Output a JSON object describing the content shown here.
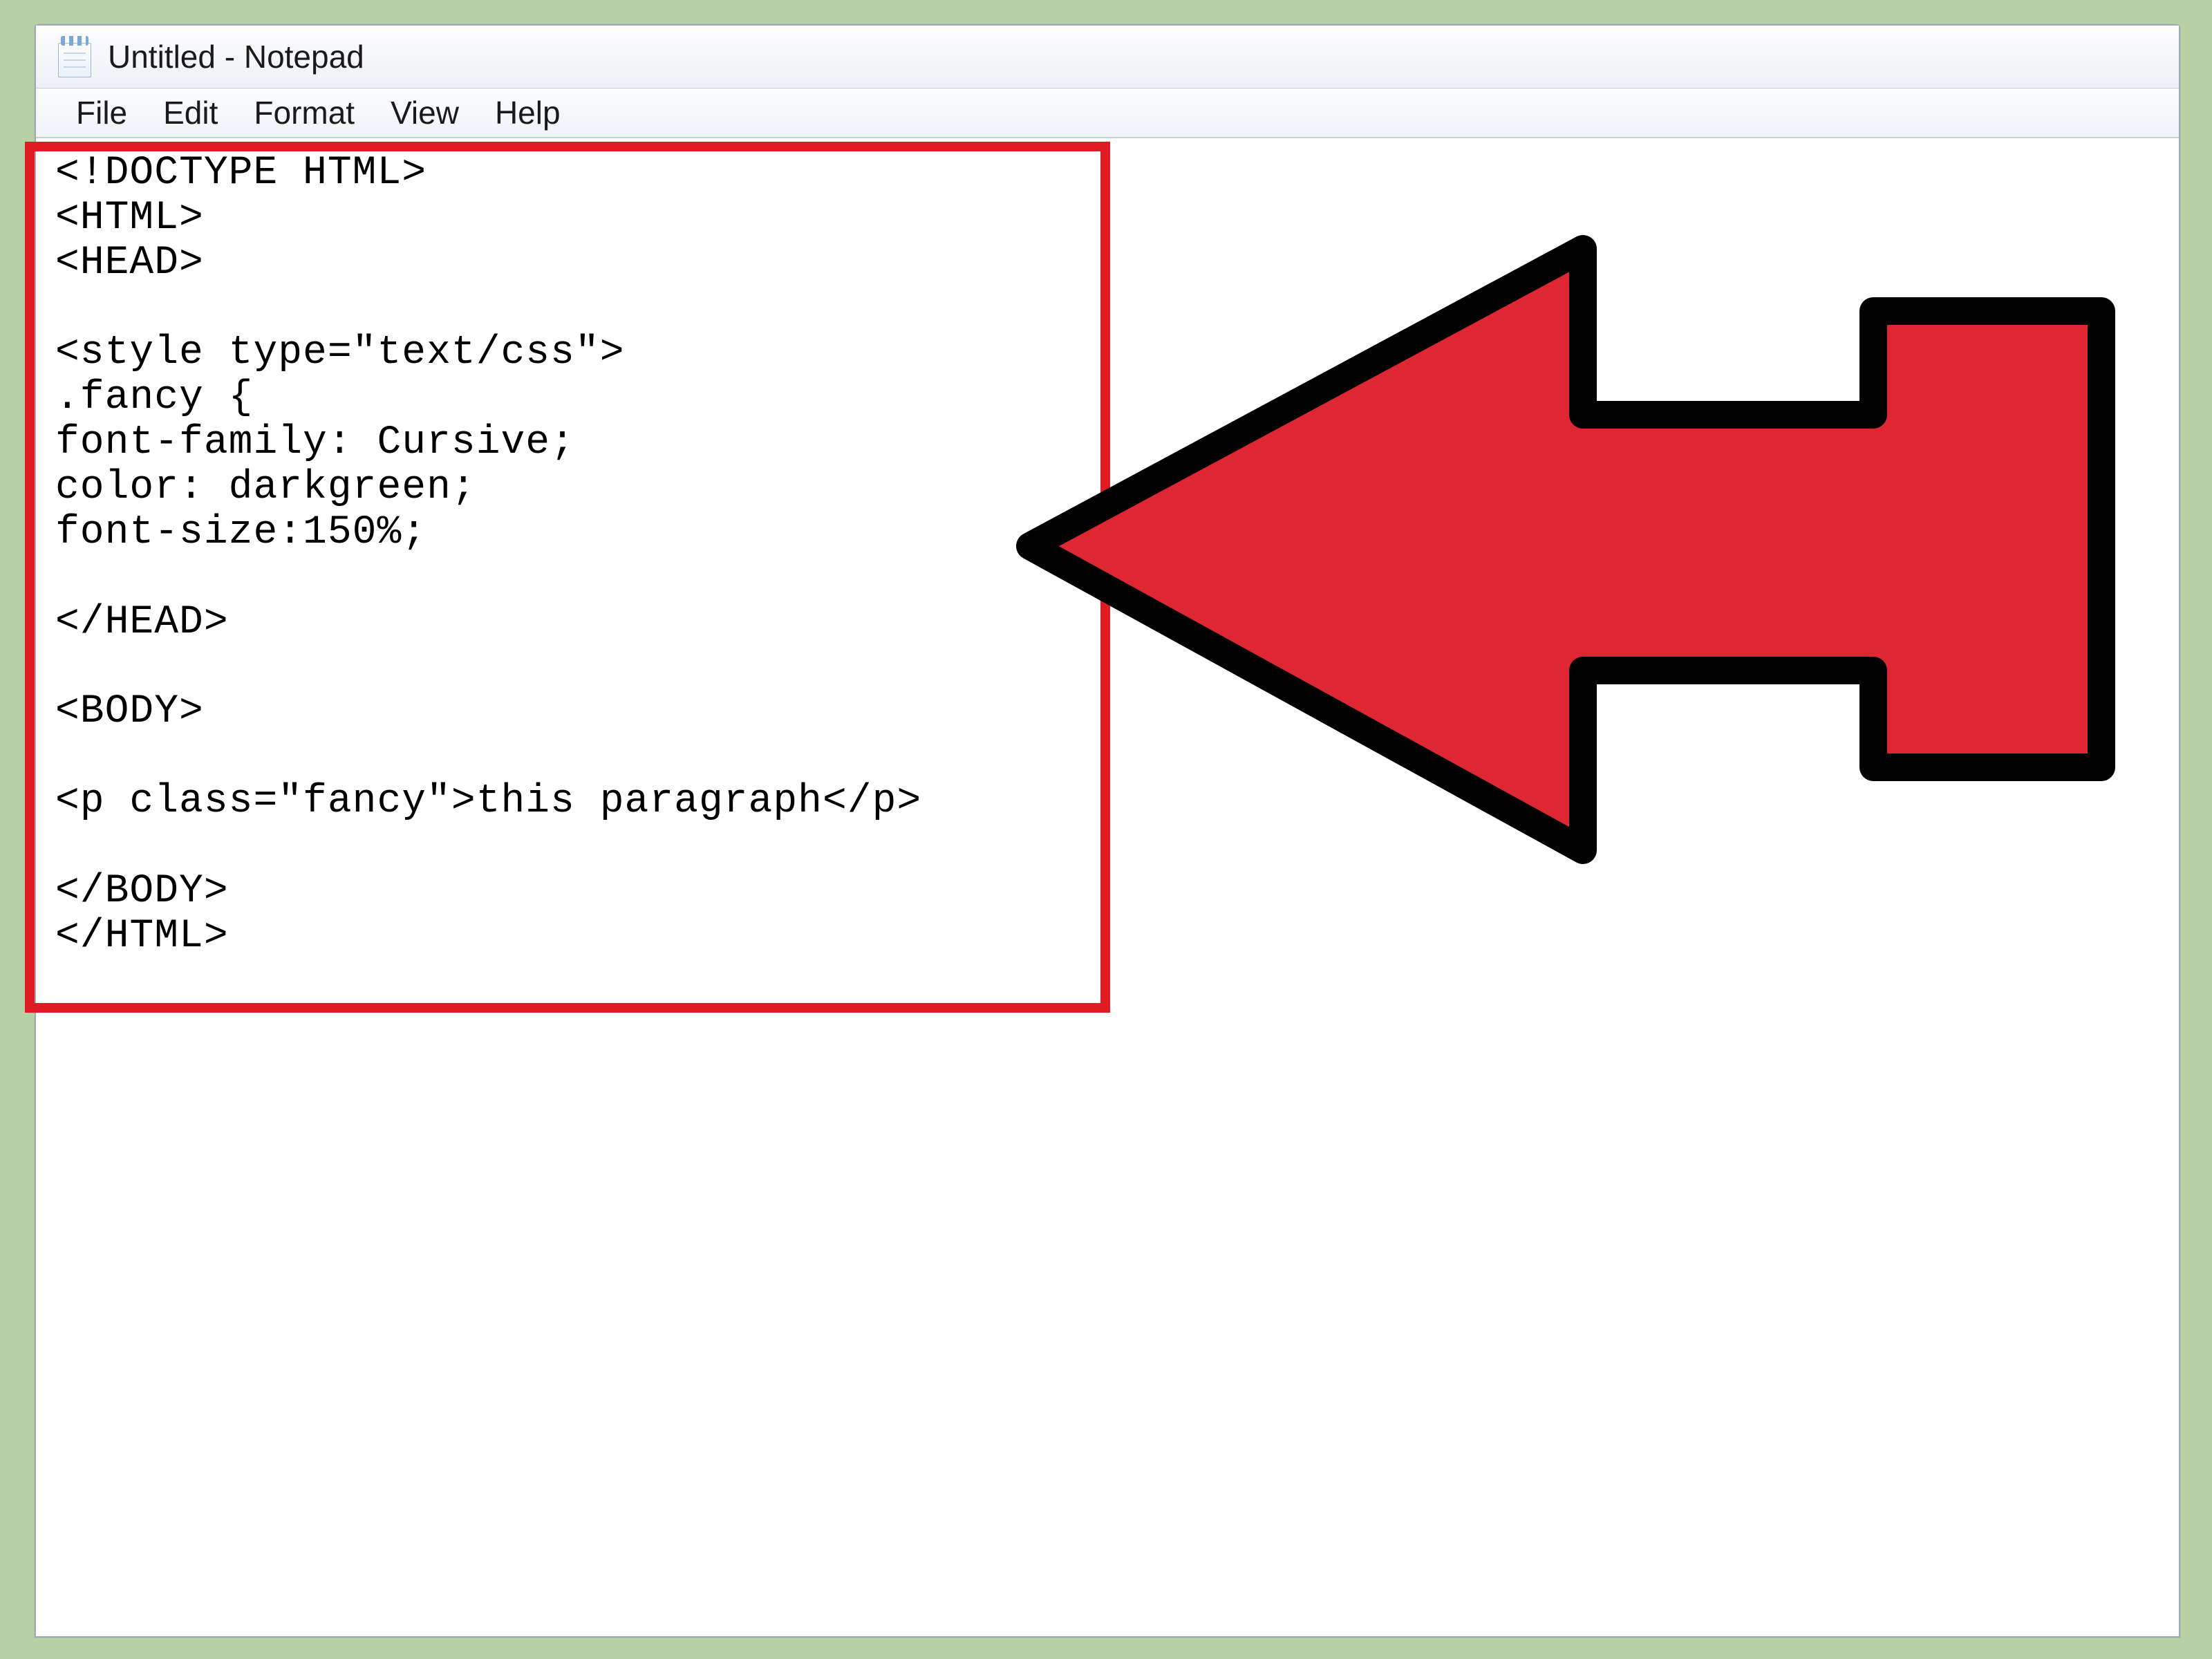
{
  "window": {
    "title": "Untitled - Notepad"
  },
  "menubar": {
    "items": [
      "File",
      "Edit",
      "Format",
      "View",
      "Help"
    ]
  },
  "editor": {
    "text": "<!DOCTYPE HTML>\n<HTML>\n<HEAD>\n\n<style type=\"text/css\">\n.fancy {\nfont-family: Cursive;\ncolor: darkgreen;\nfont-size:150%;\n\n</HEAD>\n\n<BODY>\n\n<p class=\"fancy\">this paragraph</p>\n\n</BODY>\n</HTML>"
  },
  "annotations": {
    "highlight_color": "#e01b24",
    "arrow_fill": "#df2734",
    "arrow_stroke": "#000000"
  }
}
